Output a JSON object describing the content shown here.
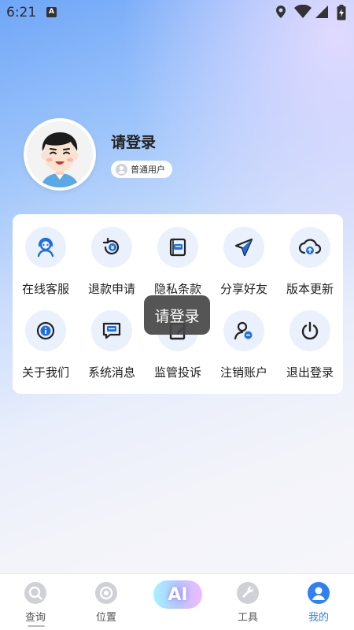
{
  "status_bar": {
    "time": "6:21",
    "notification_badge": "A",
    "icons": [
      "location-icon",
      "wifi-icon",
      "signal-icon",
      "battery-icon"
    ]
  },
  "profile": {
    "login_prompt": "请登录",
    "user_type": "普通用户"
  },
  "menu": {
    "items": [
      {
        "label": "在线客服",
        "icon": "customer-service-icon"
      },
      {
        "label": "退款申请",
        "icon": "refund-icon"
      },
      {
        "label": "隐私条款",
        "icon": "privacy-icon"
      },
      {
        "label": "分享好友",
        "icon": "share-icon"
      },
      {
        "label": "版本更新",
        "icon": "cloud-update-icon"
      },
      {
        "label": "关于我们",
        "icon": "about-icon"
      },
      {
        "label": "系统消息",
        "icon": "message-icon"
      },
      {
        "label": "监管投诉",
        "icon": "complaint-icon"
      },
      {
        "label": "注销账户",
        "icon": "delete-account-icon"
      },
      {
        "label": "退出登录",
        "icon": "power-icon"
      }
    ]
  },
  "toast": {
    "text": "请登录"
  },
  "bottom_nav": {
    "items": [
      {
        "label": "查询",
        "icon": "search-icon"
      },
      {
        "label": "位置",
        "icon": "location-target-icon"
      },
      {
        "label": "AI",
        "icon": "ai-icon"
      },
      {
        "label": "工具",
        "icon": "wrench-icon"
      },
      {
        "label": "我的",
        "icon": "profile-icon",
        "active": true
      }
    ]
  },
  "colors": {
    "accent": "#2f7ff6",
    "icon_blue": "#1e6fe0",
    "circle_bg": "#eaf1fc"
  }
}
